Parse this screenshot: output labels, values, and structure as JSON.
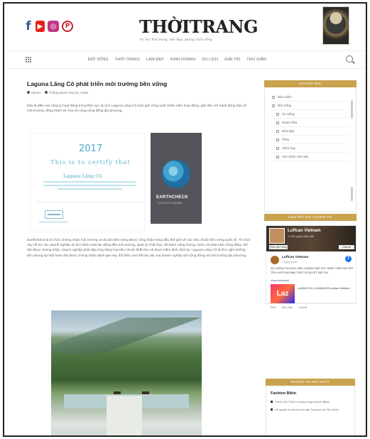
{
  "header": {
    "social_icons": [
      {
        "name": "facebook-icon",
        "glyph": "f"
      },
      {
        "name": "youtube-icon",
        "glyph": "▶"
      },
      {
        "name": "instagram-icon",
        "glyph": "◎"
      },
      {
        "name": "pinterest-icon",
        "glyph": "P"
      }
    ],
    "logo": "THỜITRANG",
    "logo_tagline": "Tin tức thời trang, làm đẹp, phong cách sống"
  },
  "nav": {
    "items": [
      "ĐỜI SỐNG",
      "THỜI TRANG",
      "LÀM ĐẸP",
      "KINH DOANH",
      "DU LỊCH",
      "GIẢI TRÍ",
      "THƯ GIÃN"
    ]
  },
  "article": {
    "title": "Laguna Lăng Cô phát triển môi trường bền vững",
    "author": "admin",
    "date": "Tháng Mười Hai 22, 2018",
    "intro": "Đây là điều mà công ty hoạt động trong lĩnh vực du lịch Laguna Lăng Cô luôn giữ vững suốt nhiều năm hoạt động, gắn liền với hành động bảo vệ môi trường, đồng hành và chia sẻ cùng cộng đồng địa phương.",
    "certificate": {
      "year": "2017",
      "line": "This is to certify that",
      "name": "Laguna Lăng Cô",
      "brand": "EARTHCHECK",
      "brand_sub": "SCIENCE BASED"
    },
    "body": "EarthCheck là tổ chức chứng nhận môi trường và du lịch bền vững được công nhận hàng đầu thế giới về các tiêu chuẩn bền vững quốc tế. Tổ chức này hỗ trợ các doanh nghiệp du lịch kiểm soát tác động đến môi trường, quản lý chất thải, tiết kiệm năng lượng, nước và phát triển cộng đồng. Để đạt được chứng nhận, doanh nghiệp phải đáp ứng hàng loạt tiêu chuẩn khắt khe và được kiểm định định kỳ. Laguna Lăng Cô là khu nghỉ dưỡng tiên phong tại Việt Nam đạt được chứng nhận danh giá này, thể hiện cam kết lâu dài của doanh nghiệp với cộng đồng và môi trường địa phương."
  },
  "sidebar": {
    "categories_title": "CHUYÊN MỤC",
    "categories": [
      {
        "label": "Bảo Hiểm",
        "sub": false
      },
      {
        "label": "Đời Sống",
        "sub": false
      },
      {
        "label": "Ăn Uống",
        "sub": true
      },
      {
        "label": "Khám Phá",
        "sub": true
      },
      {
        "label": "Nhà đẹp",
        "sub": true
      },
      {
        "label": "Phim",
        "sub": true
      },
      {
        "label": "Sách hay",
        "sub": true
      },
      {
        "label": "Sức khỏe sinh sản",
        "sub": true
      }
    ],
    "fb_title": "LIÊN KẾT VỚI CHÚNG TÔI",
    "fb_page_name": "Luffcan Vietnam",
    "fb_page_followers": "2.316 người theo dõi",
    "fb_follow": "Theo dõi Trang",
    "fb_share": "Chia sẻ",
    "fb_post_name": "Luffcan Vietnam",
    "fb_post_time": "1 ngày trước",
    "fb_post_text": "[SỰ KIỆN] THƯƠNG HIỆU NHÀNG ĐẸP HOT NHẤT HIỆN NAY ĐỔI TÊN LUFFCAN BÀN THỨC BÍ QUYẾT ĐẸP DA",
    "fb_post_link": "shope.ee/abcdef",
    "laz_logo": "Laz",
    "laz_text": "LAZADA VN | LAZADA.VN\nLuffcan Vietnam...",
    "fb_actions": [
      "Thích",
      "Bình luận",
      "Chia sẻ"
    ],
    "news_title": "NHỮNG TIN MỚI NHẤT",
    "news_category": "Fashion Bikin",
    "news_items": [
      "Trend 2017 khởi hương cùng mùa hè Bikini",
      "Vẻ quyến rũ của bộ sưu tập Trang tự do Phú Quốc"
    ]
  },
  "colors": {
    "accent": "#c9a24e",
    "link": "#385898",
    "facebook": "#1877f2"
  }
}
